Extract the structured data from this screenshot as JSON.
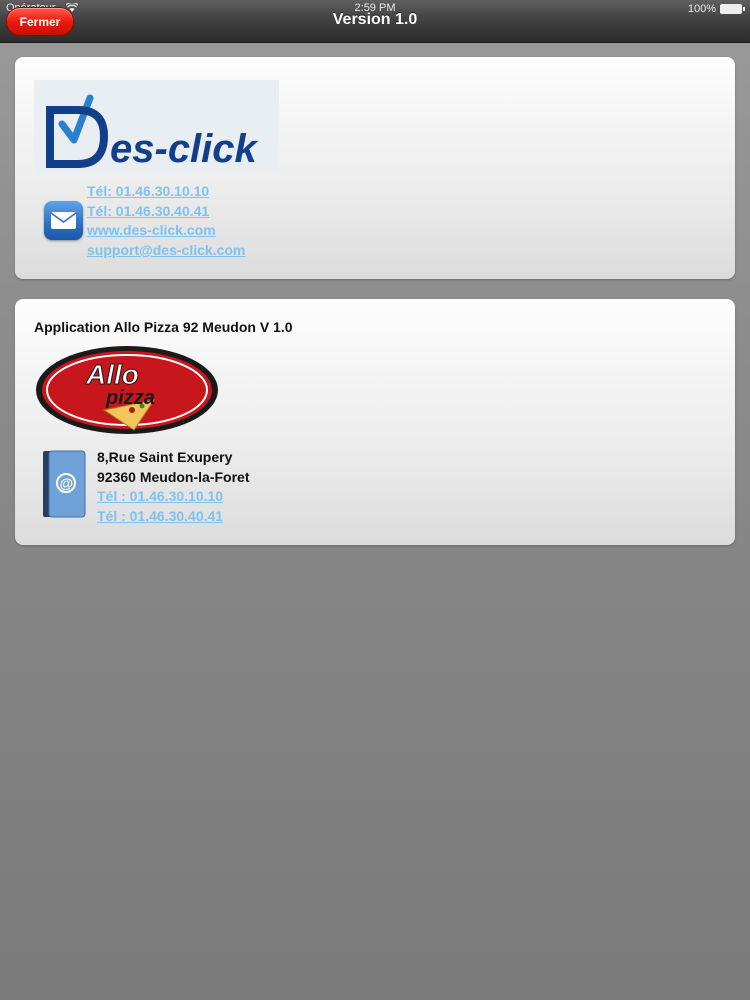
{
  "status_bar": {
    "carrier": "Opérateur",
    "time": "2:59 PM",
    "battery": "100%"
  },
  "nav": {
    "title": "Version 1.0",
    "close_label": "Fermer"
  },
  "developer": {
    "logo_text": "Des-click",
    "phone1": "Tél: 01.46.30.10.10",
    "phone2": "Tél: 01.46.30.40.41",
    "website": "www.des-click.com",
    "email": "support@des-click.com"
  },
  "restaurant": {
    "app_title": "Application Allo Pizza 92 Meudon V 1.0",
    "logo_text_top": "Allo",
    "logo_text_bottom": "pizza",
    "address_line1": "8,Rue Saint Exupery",
    "address_line2": "92360 Meudon-la-Foret",
    "phone1": "Tél : 01.46.30.10.10",
    "phone2": "Tél : 01.46.30.40.41"
  },
  "colors": {
    "link": "#7fc2ee",
    "close_button": "#e8170a",
    "brand_blue": "#1a4fa0"
  }
}
